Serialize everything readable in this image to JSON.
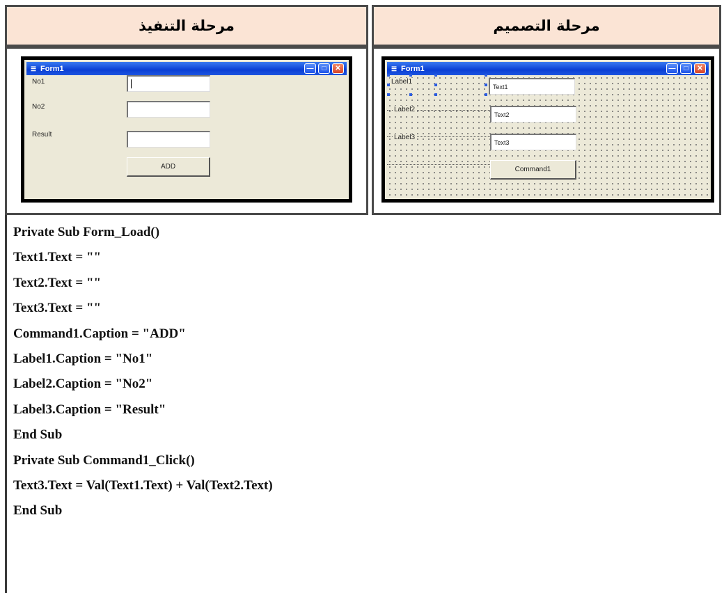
{
  "headers": {
    "execution": "مرحلة التنفيذ",
    "design": "مرحلة التصميم"
  },
  "run_form": {
    "title": "Form1",
    "labels": [
      "No1",
      "No2",
      "Result"
    ],
    "button": "ADD"
  },
  "design_form": {
    "title": "Form1",
    "labels": [
      "Label1",
      "Label2",
      "Label3"
    ],
    "textboxes": [
      "Text1",
      "Text2",
      "Text3"
    ],
    "button": "Command1"
  },
  "code_lines": [
    "Private Sub Form_Load()",
    "Text1.Text = \"\"",
    "Text2.Text = \"\"",
    "Text3.Text = \"\"",
    "Command1.Caption = \"ADD\"",
    "Label1.Caption = \"No1\"",
    "Label2.Caption = \"No2\"",
    "Label3.Caption = \"Result\"",
    "End Sub",
    "Private Sub Command1_Click()",
    "Text3.Text = Val(Text1.Text) + Val(Text2.Text)",
    "End Sub"
  ]
}
